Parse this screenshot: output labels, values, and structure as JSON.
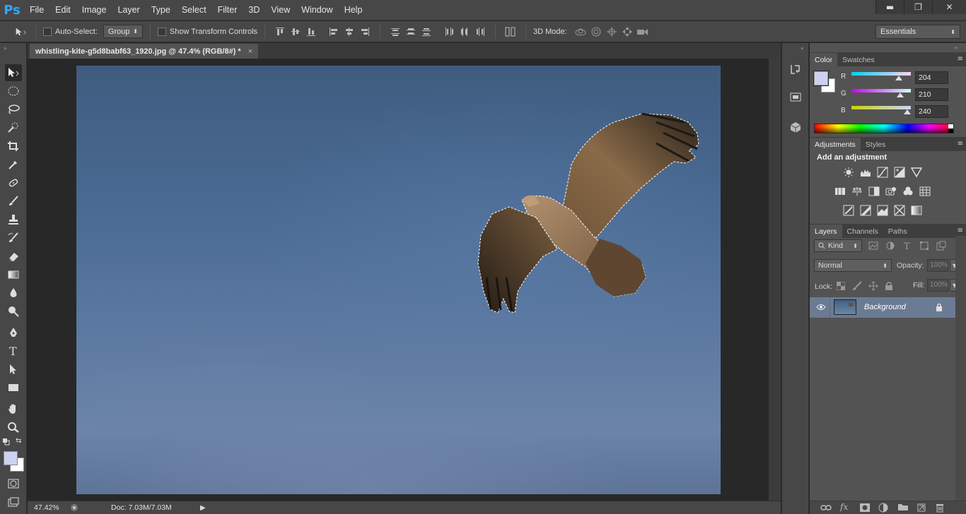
{
  "app": {
    "logo": "Ps"
  },
  "menu": [
    "File",
    "Edit",
    "Image",
    "Layer",
    "Type",
    "Select",
    "Filter",
    "3D",
    "View",
    "Window",
    "Help"
  ],
  "window_controls": {
    "minimize": "▬",
    "restore": "❐",
    "close": "✕"
  },
  "options": {
    "auto_select_label": "Auto-Select:",
    "auto_select_value": "Group",
    "show_transform_label": "Show Transform Controls",
    "mode_3d_label": "3D Mode:",
    "workspace": "Essentials"
  },
  "document": {
    "tab_title": "whistling-kite-g5d8babf63_1920.jpg @ 47.4% (RGB/8#) *",
    "close": "×"
  },
  "status": {
    "zoom": "47.42%",
    "doc_info": "Doc: 7.03M/7.03M"
  },
  "color_panel": {
    "tabs": [
      "Color",
      "Swatches"
    ],
    "r_label": "R",
    "g_label": "G",
    "b_label": "B",
    "r": "204",
    "g": "210",
    "b": "240",
    "r_fraction": 0.8,
    "g_fraction": 0.824,
    "b_fraction": 0.941,
    "foreground": "#ccd2f0",
    "background": "#ffffff"
  },
  "adjustments_panel": {
    "tabs": [
      "Adjustments",
      "Styles"
    ],
    "heading": "Add an adjustment"
  },
  "layers_panel": {
    "tabs": [
      "Layers",
      "Channels",
      "Paths"
    ],
    "filter_kind": "Kind",
    "blend_mode": "Normal",
    "opacity_label": "Opacity:",
    "opacity_value": "100%",
    "lock_label": "Lock:",
    "fill_label": "Fill:",
    "fill_value": "100%",
    "layers": [
      {
        "name": "Background",
        "visible": true,
        "locked": true
      }
    ]
  },
  "colors": {
    "accent": "#31a8ff",
    "selected_layer": "#6a7b93"
  }
}
